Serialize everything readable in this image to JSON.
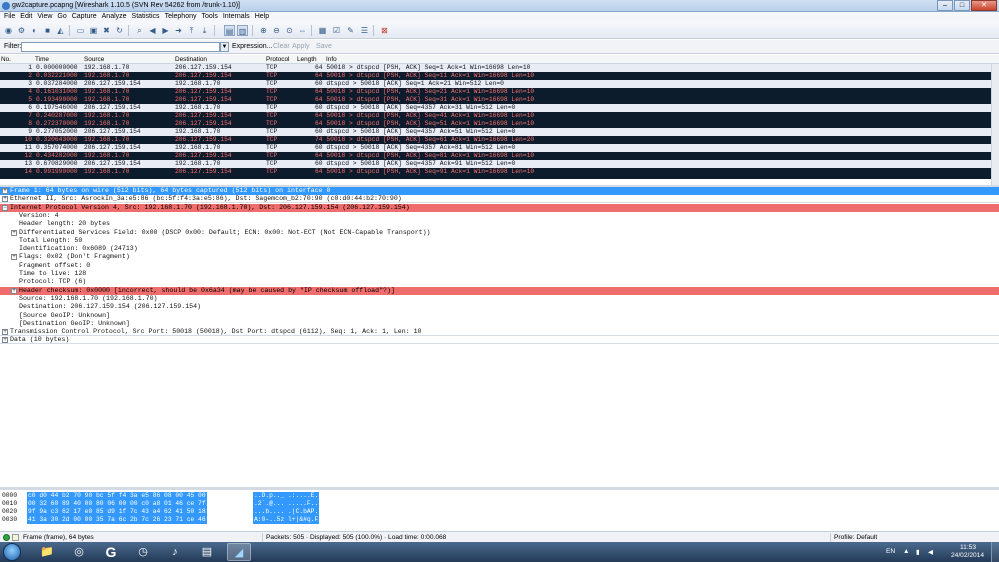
{
  "window": {
    "title": "gw2capture.pcapng  [Wireshark 1.10.5  (SVN Rev 54262 from /trunk-1.10)]",
    "buttons": {
      "minimize": "–",
      "maximize": "□",
      "close": "✕"
    }
  },
  "menubar": {
    "items": [
      "File",
      "Edit",
      "View",
      "Go",
      "Capture",
      "Analyze",
      "Statistics",
      "Telephony",
      "Tools",
      "Internals",
      "Help"
    ]
  },
  "filterbar": {
    "label": "Filter:",
    "value": "",
    "expression": "Expression...",
    "clear": "Clear",
    "apply": "Apply",
    "save": "Save"
  },
  "packet_list": {
    "columns": [
      "No.",
      "Time",
      "Source",
      "Destination",
      "Protocol",
      "Length",
      "Info"
    ],
    "rows": [
      {
        "no": "1",
        "time": "0.000000000",
        "src": "192.168.1.70",
        "dst": "206.127.159.154",
        "proto": "TCP",
        "info": "64 50018 > dtspcd [PSH, ACK] Seq=1 Ack=1 Win=16698 Len=10",
        "style": "light"
      },
      {
        "no": "2",
        "time": "0.032221000",
        "src": "192.168.1.70",
        "dst": "206.127.159.154",
        "proto": "TCP",
        "info": "64 50018 > dtspcd [PSH, ACK] Seq=11 Ack=1 Win=16698 Len=10",
        "style": "dark"
      },
      {
        "no": "3",
        "time": "0.037284000",
        "src": "206.127.159.154",
        "dst": "192.168.1.70",
        "proto": "TCP",
        "info": "60 dtspcd > 50018 [ACK] Seq=1 Ack=21 Win=512 Len=0",
        "style": "light"
      },
      {
        "no": "4",
        "time": "0.161031000",
        "src": "192.168.1.70",
        "dst": "206.127.159.154",
        "proto": "TCP",
        "info": "64 50018 > dtspcd [PSH, ACK] Seq=21 Ack=1 Win=16698 Len=10",
        "style": "dark"
      },
      {
        "no": "5",
        "time": "0.193490000",
        "src": "192.168.1.70",
        "dst": "206.127.159.154",
        "proto": "TCP",
        "info": "64 50018 > dtspcd [PSH, ACK] Seq=31 Ack=1 Win=16698 Len=10",
        "style": "dark"
      },
      {
        "no": "6",
        "time": "0.197546000",
        "src": "206.127.159.154",
        "dst": "192.168.1.70",
        "proto": "TCP",
        "info": "60 dtspcd > 50018 [ACK] Seq=4357 Ack=31 Win=512 Len=0",
        "style": "light"
      },
      {
        "no": "7",
        "time": "0.240287000",
        "src": "192.168.1.70",
        "dst": "206.127.159.154",
        "proto": "TCP",
        "info": "64 50018 > dtspcd [PSH, ACK] Seq=41 Ack=1 Win=16698 Len=10",
        "style": "dark"
      },
      {
        "no": "8",
        "time": "0.272370000",
        "src": "192.168.1.70",
        "dst": "206.127.159.154",
        "proto": "TCP",
        "info": "64 50018 > dtspcd [PSH, ACK] Seq=51 Ack=1 Win=16698 Len=10",
        "style": "dark"
      },
      {
        "no": "9",
        "time": "0.277052000",
        "src": "206.127.159.154",
        "dst": "192.168.1.70",
        "proto": "TCP",
        "info": "60 dtspcd > 50018 [ACK] Seq=4357 Ack=51 Win=512 Len=0",
        "style": "light"
      },
      {
        "no": "10",
        "time": "0.320643000",
        "src": "192.168.1.70",
        "dst": "206.127.159.154",
        "proto": "TCP",
        "info": "74 50018 > dtspcd [PSH, ACK] Seq=61 Ack=1 Win=16698 Len=20",
        "style": "dark"
      },
      {
        "no": "11",
        "time": "0.357074000",
        "src": "206.127.159.154",
        "dst": "192.168.1.70",
        "proto": "TCP",
        "info": "60 dtspcd > 50018 [ACK] Seq=4357 Ack=81 Win=512 Len=0",
        "style": "light"
      },
      {
        "no": "12",
        "time": "0.434282000",
        "src": "192.168.1.70",
        "dst": "206.127.159.154",
        "proto": "TCP",
        "info": "64 50018 > dtspcd [PSH, ACK] Seq=81 Ack=1 Win=16698 Len=10",
        "style": "dark"
      },
      {
        "no": "13",
        "time": "0.670829000",
        "src": "206.127.159.154",
        "dst": "192.168.1.70",
        "proto": "TCP",
        "info": "60 dtspcd > 50018 [ACK] Seq=4357 Ack=91 Win=512 Len=0",
        "style": "light"
      },
      {
        "no": "14",
        "time": "0.991990000",
        "src": "192.168.1.70",
        "dst": "206.127.159.154",
        "proto": "TCP",
        "info": "64 50018 > dtspcd [PSH, ACK] Seq=91 Ack=1 Win=16698 Len=10",
        "style": "dark"
      }
    ]
  },
  "details": {
    "rows": [
      {
        "text": "Frame 1: 64 bytes on wire (512 bits), 64 bytes captured (512 bits) on interface 0",
        "indent": 0,
        "expander": "+",
        "style": "sel"
      },
      {
        "text": "Ethernet II, Src: AsrockIn_3a:e5:86 (bc:5f:f4:3a:e5:86), Dst: Sagemcom_b2:70:90 (c0:d0:44:b2:70:90)",
        "indent": 0,
        "expander": "+",
        "style": "plain"
      },
      {
        "text": "Internet Protocol Version 4, Src: 192.168.1.70 (192.168.1.70), Dst: 206.127.159.154 (206.127.159.154)",
        "indent": 0,
        "expander": "−",
        "style": "err"
      },
      {
        "text": "Version: 4",
        "indent": 1,
        "expander": "",
        "style": "plain"
      },
      {
        "text": "Header length: 20 bytes",
        "indent": 1,
        "expander": "",
        "style": "plain"
      },
      {
        "text": "Differentiated Services Field: 0x00 (DSCP 0x00: Default; ECN: 0x00: Not-ECT (Not ECN-Capable Transport))",
        "indent": 1,
        "expander": "+",
        "style": "plain"
      },
      {
        "text": "Total Length: 50",
        "indent": 1,
        "expander": "",
        "style": "plain"
      },
      {
        "text": "Identification: 0x6089 (24713)",
        "indent": 1,
        "expander": "",
        "style": "plain"
      },
      {
        "text": "Flags: 0x02 (Don't Fragment)",
        "indent": 1,
        "expander": "+",
        "style": "plain"
      },
      {
        "text": "Fragment offset: 0",
        "indent": 1,
        "expander": "",
        "style": "plain"
      },
      {
        "text": "Time to live: 128",
        "indent": 1,
        "expander": "",
        "style": "plain"
      },
      {
        "text": "Protocol: TCP (6)",
        "indent": 1,
        "expander": "",
        "style": "plain"
      },
      {
        "text": "Header checksum: 0x0000 [incorrect, should be 0x6a34 (may be caused by \"IP checksum offload\"?)]",
        "indent": 1,
        "expander": "+",
        "style": "err"
      },
      {
        "text": "Source: 192.168.1.70 (192.168.1.70)",
        "indent": 1,
        "expander": "",
        "style": "plain"
      },
      {
        "text": "Destination: 206.127.159.154 (206.127.159.154)",
        "indent": 1,
        "expander": "",
        "style": "plain"
      },
      {
        "text": "[Source GeoIP: Unknown]",
        "indent": 1,
        "expander": "",
        "style": "plain"
      },
      {
        "text": "[Destination GeoIP: Unknown]",
        "indent": 1,
        "expander": "",
        "style": "plain"
      },
      {
        "text": "Transmission Control Protocol, Src Port: 50018 (50018), Dst Port: dtspcd (6112), Seq: 1, Ack: 1, Len: 10",
        "indent": 0,
        "expander": "+",
        "style": "plain"
      },
      {
        "text": "Data (10 bytes)",
        "indent": 0,
        "expander": "+",
        "style": "plain"
      }
    ]
  },
  "bytes": {
    "rows": [
      {
        "offset": "0000",
        "hex": "c0 d0 44 b2 70 90 bc 5f  f4 3a e5 86 08 00 45 00",
        "ascii": "..D.p.._ .:....E."
      },
      {
        "offset": "0010",
        "hex": "00 32 60 89 40 00 80 06  00 00 c0 a8 01 46 ce 7f",
        "ascii": ".2`.@... .....F.."
      },
      {
        "offset": "0020",
        "hex": "9f 9a c3 62 17 e0 85 d9  1f 7c 43 a4 62 41 50 18",
        "ascii": "...b.... .|C.bAP."
      },
      {
        "offset": "0030",
        "hex": "41 3a 30 2d 00 00 35 7a  6c 2b 7c 26 23 71 ce 46",
        "ascii": "A:0-..5z l+|&#q.F"
      }
    ]
  },
  "statusbar": {
    "frame": "Frame (frame), 64 bytes",
    "packets": "Packets: 505 · Displayed: 505 (100.0%) · Load time: 0:00.068",
    "profile": "Profile: Default"
  },
  "taskbar": {
    "language": "EN",
    "time": "11:53",
    "date": "24/02/2014"
  },
  "colors": {
    "selected": "#3399ff",
    "error": "#f06d6d",
    "dark_row_bg": "#0c1c2c",
    "dark_row_fg": "#f36f6f",
    "light_row_bg": "#e8ecf4"
  }
}
